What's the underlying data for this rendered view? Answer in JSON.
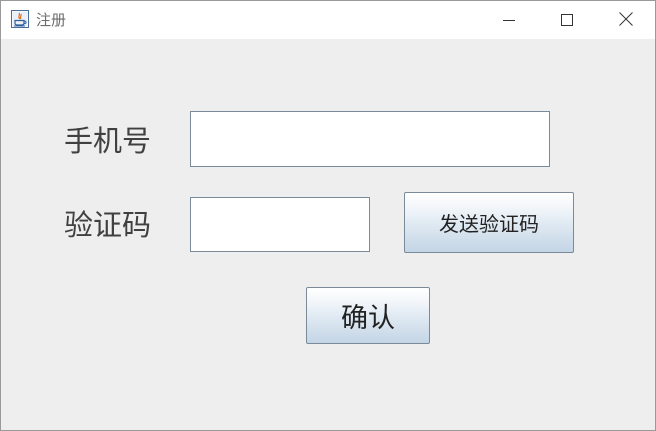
{
  "window": {
    "title": "注册",
    "icons": {
      "app": "java-app-icon",
      "minimize": "minimize-icon",
      "maximize": "maximize-icon",
      "close": "close-icon"
    }
  },
  "form": {
    "phone_label": "手机号",
    "phone_value": "",
    "code_label": "验证码",
    "code_value": "",
    "send_code_button": "发送验证码",
    "confirm_button": "确认"
  },
  "colors": {
    "background": "#eeeeee",
    "titlebar": "#ffffff",
    "button_border": "#7a8a99",
    "button_gradient_bottom": "#c4d5e6"
  }
}
